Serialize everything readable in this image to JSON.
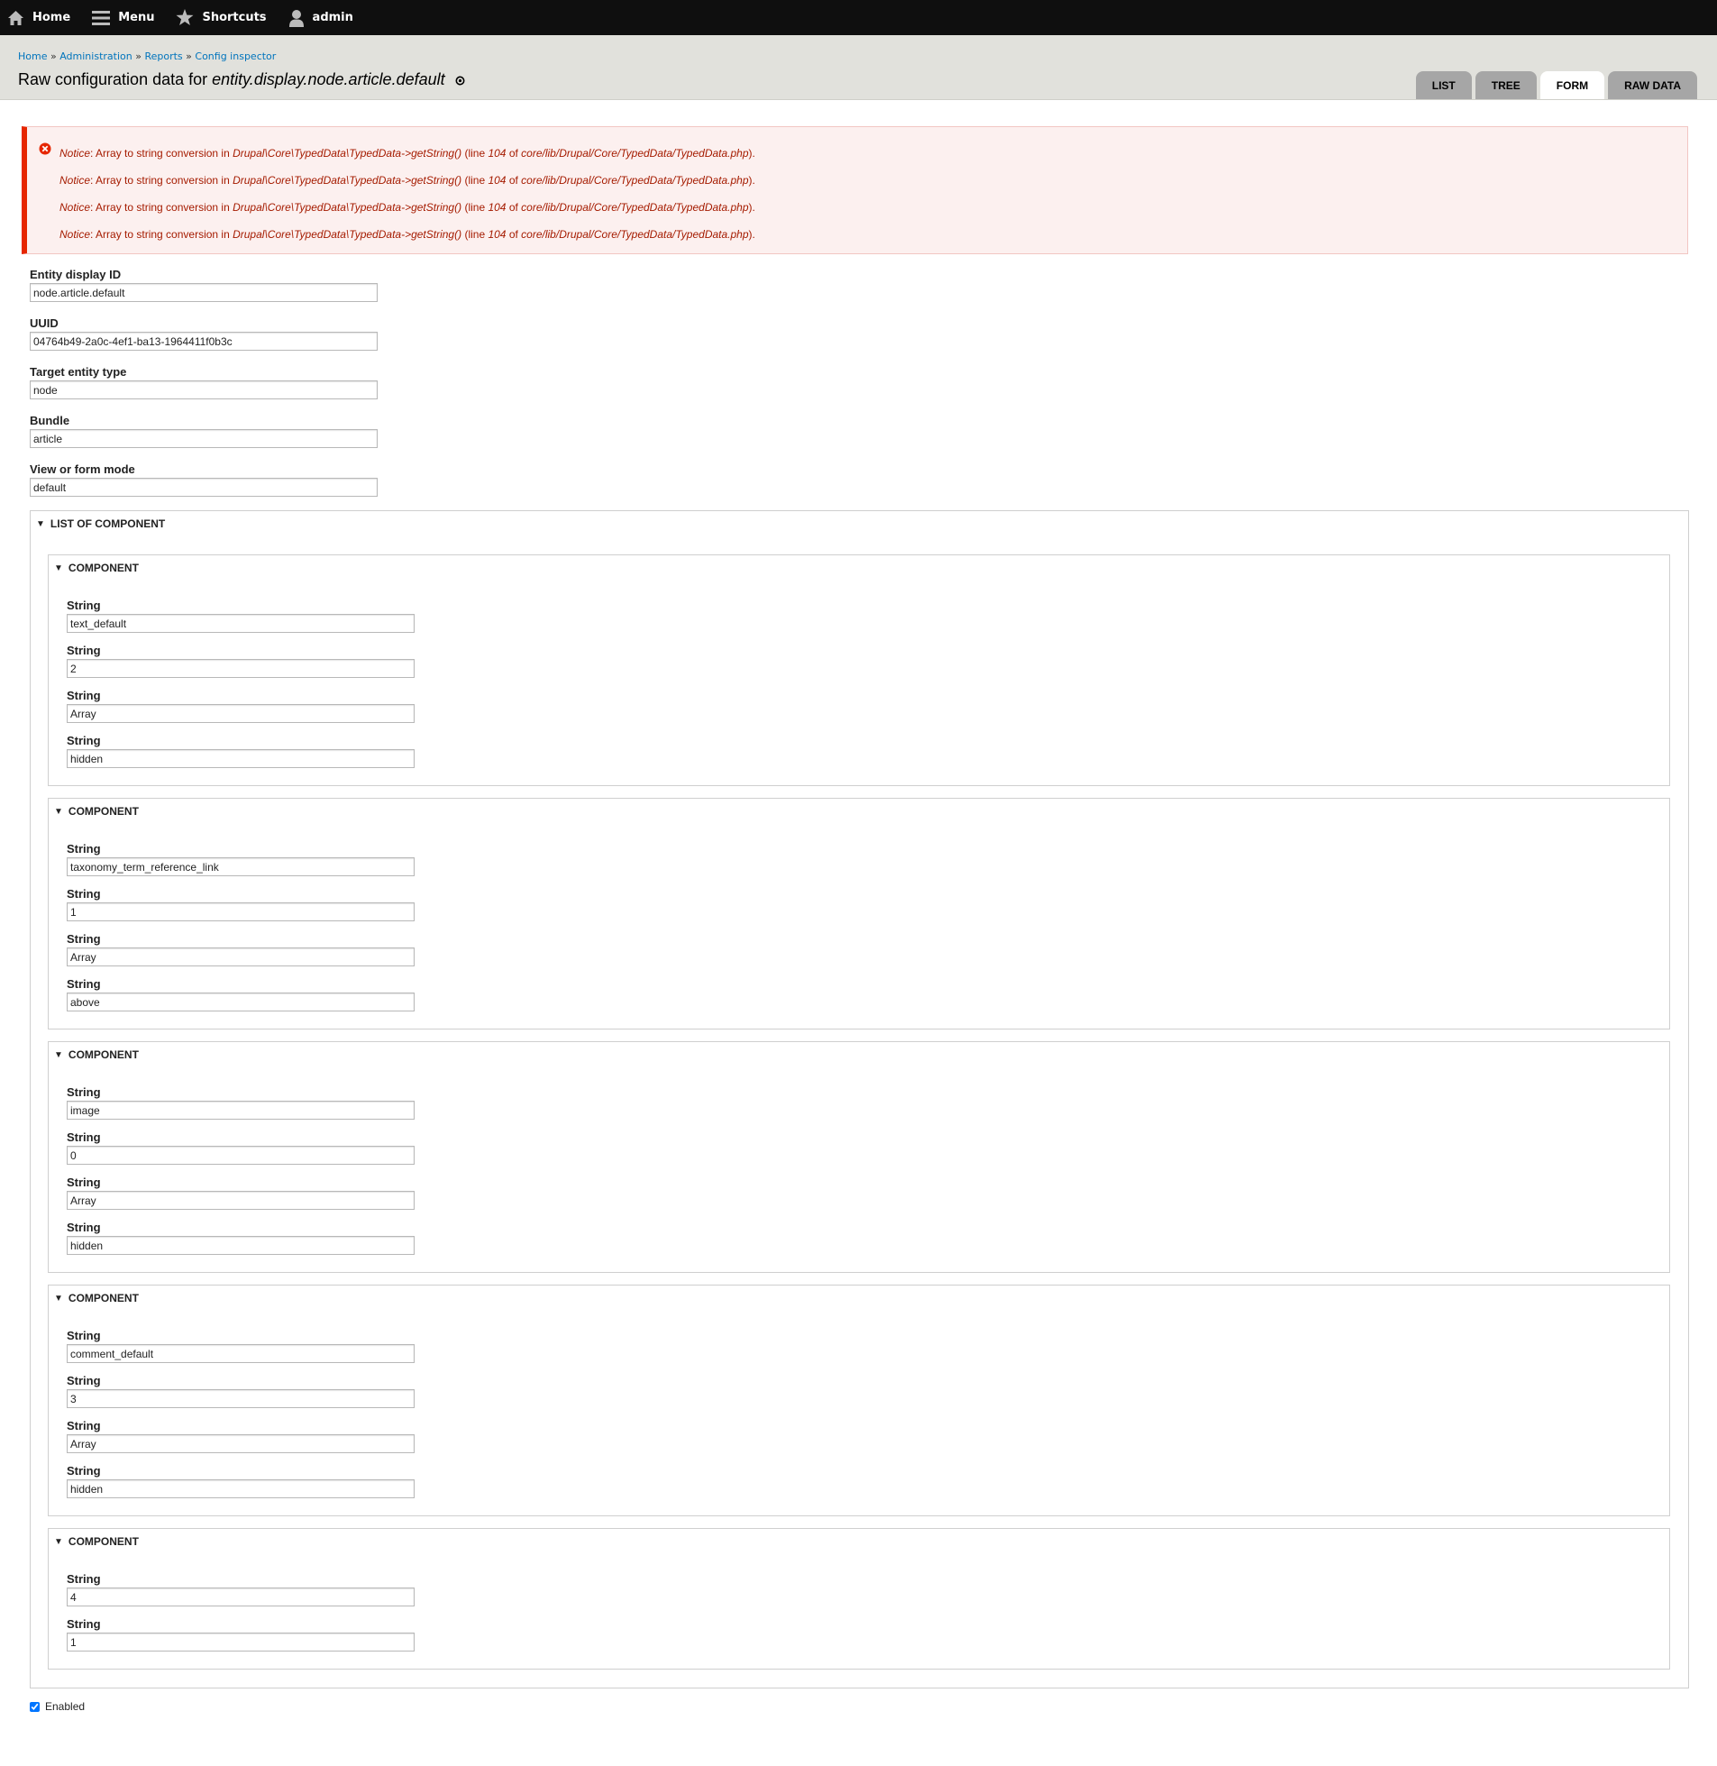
{
  "toolbar": {
    "home": "Home",
    "menu": "Menu",
    "shortcuts": "Shortcuts",
    "user": "admin"
  },
  "breadcrumb": {
    "items": [
      "Home",
      "Administration",
      "Reports",
      "Config inspector"
    ],
    "separator": "»"
  },
  "page": {
    "title_prefix": "Raw configuration data for ",
    "title_name": "entity.display.node.article.default"
  },
  "tabs": [
    {
      "label": "LIST",
      "active": false
    },
    {
      "label": "TREE",
      "active": false
    },
    {
      "label": "FORM",
      "active": true
    },
    {
      "label": "RAW DATA",
      "active": false
    }
  ],
  "messages": {
    "notice_label": "Notice",
    "text": ": Array to string conversion in ",
    "method": "Drupal\\Core\\TypedData\\TypedData->getString()",
    "line_prefix": " (line ",
    "line": "104",
    "of": " of ",
    "file": "core/lib/Drupal/Core/TypedData/TypedData.php",
    "suffix": ")."
  },
  "fields": [
    {
      "label": "Entity display ID",
      "value": "node.article.default"
    },
    {
      "label": "UUID",
      "value": "04764b49-2a0c-4ef1-ba13-1964411f0b3c"
    },
    {
      "label": "Target entity type",
      "value": "node"
    },
    {
      "label": "Bundle",
      "value": "article"
    },
    {
      "label": "View or form mode",
      "value": "default"
    }
  ],
  "list_legend": "LIST OF COMPONENT",
  "component_legend": "COMPONENT",
  "string_label": "String",
  "components": [
    {
      "values": [
        "text_default",
        "2",
        "Array",
        "hidden"
      ]
    },
    {
      "values": [
        "taxonomy_term_reference_link",
        "1",
        "Array",
        "above"
      ]
    },
    {
      "values": [
        "image",
        "0",
        "Array",
        "hidden"
      ]
    },
    {
      "values": [
        "comment_default",
        "3",
        "Array",
        "hidden"
      ]
    },
    {
      "values": [
        "4",
        "1"
      ]
    }
  ],
  "enabled": {
    "label": "Enabled",
    "checked": true
  },
  "colors": {
    "toolbar_bg": "#0f0f0f",
    "header_bg": "#e1e1dc",
    "link": "#0074bd",
    "error_text": "#a51b00",
    "error_border": "#e62600",
    "error_bg": "#fcf0ef"
  }
}
